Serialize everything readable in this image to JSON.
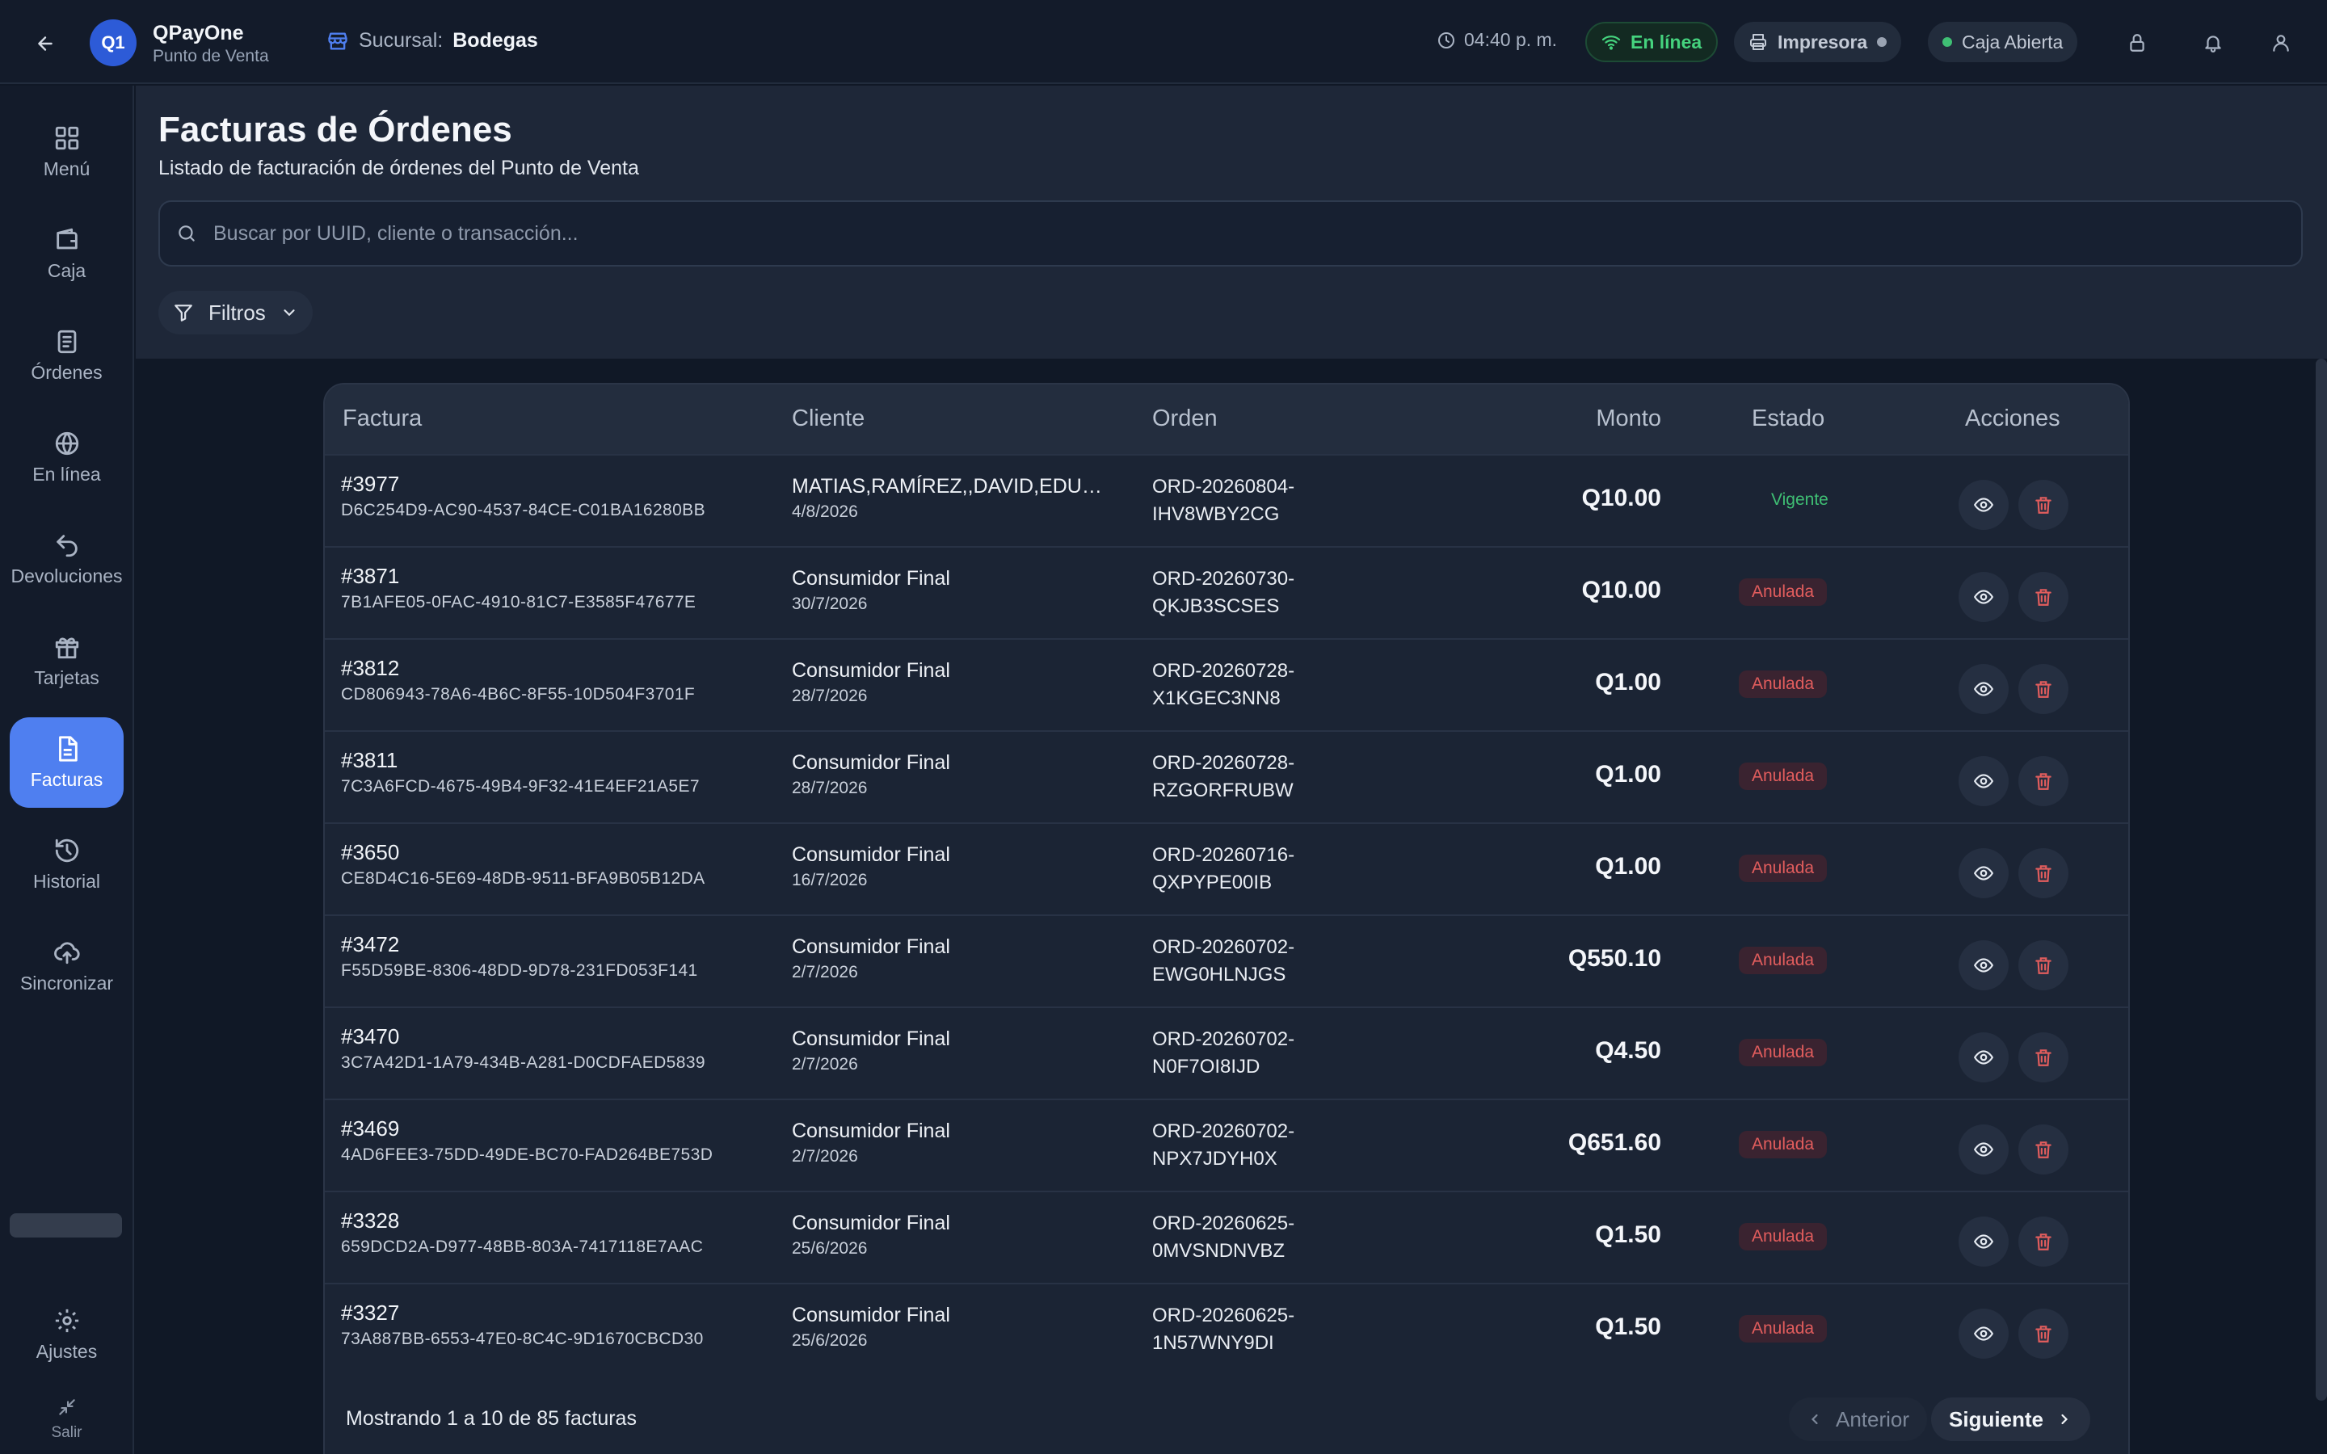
{
  "topbar": {
    "app_name": "QPayOne",
    "app_subtitle": "Punto de Venta",
    "logo_text": "Q1",
    "branch_label": "Sucursal:",
    "branch_name": "Bodegas",
    "time": "04:40 p. m.",
    "online_label": "En línea",
    "printer_label": "Impresora",
    "cash_label": "Caja Abierta",
    "colors": {
      "online": "#45d37e",
      "cash_dot": "#3fbf74",
      "printer_dot": "#9aa3b2"
    }
  },
  "sidebar": {
    "items": [
      {
        "label": "Menú",
        "icon": "grid-icon"
      },
      {
        "label": "Caja",
        "icon": "wallet-icon"
      },
      {
        "label": "Órdenes",
        "icon": "clipboard-icon"
      },
      {
        "label": "En línea",
        "icon": "globe-icon"
      },
      {
        "label": "Devoluciones",
        "icon": "undo-icon"
      },
      {
        "label": "Tarjetas",
        "icon": "gift-icon"
      },
      {
        "label": "Facturas",
        "icon": "document-icon",
        "active": true
      },
      {
        "label": "Historial",
        "icon": "history-icon"
      },
      {
        "label": "Sincronizar",
        "icon": "cloud-upload-icon"
      }
    ],
    "settings_label": "Ajustes",
    "logout_label": "Salir",
    "accent": "#4f7ff0"
  },
  "header": {
    "title": "Facturas de Órdenes",
    "subtitle": "Listado de facturación de órdenes del Punto de Venta",
    "search_placeholder": "Buscar por UUID, cliente o transacción...",
    "filters_label": "Filtros"
  },
  "table": {
    "columns": [
      "Factura",
      "Cliente",
      "Orden",
      "Monto",
      "Estado",
      "Acciones"
    ],
    "rows": [
      {
        "number": "#3977",
        "uuid": "D6C254D9-AC90-4537-84CE-C01BA16280BB",
        "client": "MATIAS,RAMÍREZ,,DAVID,EDUAR...",
        "date": "4/8/2026",
        "order1": "ORD-20260804-",
        "order2": "IHV8WBY2CG",
        "amount": "Q10.00",
        "status": "Vigente",
        "status_type": "vigente"
      },
      {
        "number": "#3871",
        "uuid": "7B1AFE05-0FAC-4910-81C7-E3585F47677E",
        "client": "Consumidor Final",
        "date": "30/7/2026",
        "order1": "ORD-20260730-",
        "order2": "QKJB3SCSES",
        "amount": "Q10.00",
        "status": "Anulada",
        "status_type": "anulada"
      },
      {
        "number": "#3812",
        "uuid": "CD806943-78A6-4B6C-8F55-10D504F3701F",
        "client": "Consumidor Final",
        "date": "28/7/2026",
        "order1": "ORD-20260728-",
        "order2": "X1KGEC3NN8",
        "amount": "Q1.00",
        "status": "Anulada",
        "status_type": "anulada"
      },
      {
        "number": "#3811",
        "uuid": "7C3A6FCD-4675-49B4-9F32-41E4EF21A5E7",
        "client": "Consumidor Final",
        "date": "28/7/2026",
        "order1": "ORD-20260728-",
        "order2": "RZGORFRUBW",
        "amount": "Q1.00",
        "status": "Anulada",
        "status_type": "anulada"
      },
      {
        "number": "#3650",
        "uuid": "CE8D4C16-5E69-48DB-9511-BFA9B05B12DA",
        "client": "Consumidor Final",
        "date": "16/7/2026",
        "order1": "ORD-20260716-",
        "order2": "QXPYPE00IB",
        "amount": "Q1.00",
        "status": "Anulada",
        "status_type": "anulada"
      },
      {
        "number": "#3472",
        "uuid": "F55D59BE-8306-48DD-9D78-231FD053F141",
        "client": "Consumidor Final",
        "date": "2/7/2026",
        "order1": "ORD-20260702-",
        "order2": "EWG0HLNJGS",
        "amount": "Q550.10",
        "status": "Anulada",
        "status_type": "anulada"
      },
      {
        "number": "#3470",
        "uuid": "3C7A42D1-1A79-434B-A281-D0CDFAED5839",
        "client": "Consumidor Final",
        "date": "2/7/2026",
        "order1": "ORD-20260702-",
        "order2": "N0F7OI8IJD",
        "amount": "Q4.50",
        "status": "Anulada",
        "status_type": "anulada"
      },
      {
        "number": "#3469",
        "uuid": "4AD6FEE3-75DD-49DE-BC70-FAD264BE753D",
        "client": "Consumidor Final",
        "date": "2/7/2026",
        "order1": "ORD-20260702-",
        "order2": "NPX7JDYH0X",
        "amount": "Q651.60",
        "status": "Anulada",
        "status_type": "anulada"
      },
      {
        "number": "#3328",
        "uuid": "659DCD2A-D977-48BB-803A-7417118E7AAC",
        "client": "Consumidor Final",
        "date": "25/6/2026",
        "order1": "ORD-20260625-",
        "order2": "0MVSNDNVBZ",
        "amount": "Q1.50",
        "status": "Anulada",
        "status_type": "anulada"
      },
      {
        "number": "#3327",
        "uuid": "73A887BB-6553-47E0-8C4C-9D1670CBCD30",
        "client": "Consumidor Final",
        "date": "25/6/2026",
        "order1": "ORD-20260625-",
        "order2": "1N57WNY9DI",
        "amount": "Q1.50",
        "status": "Anulada",
        "status_type": "anulada"
      }
    ]
  },
  "pagination": {
    "summary": "Mostrando 1 a 10 de 85 facturas",
    "prev_label": "Anterior",
    "next_label": "Siguiente"
  }
}
